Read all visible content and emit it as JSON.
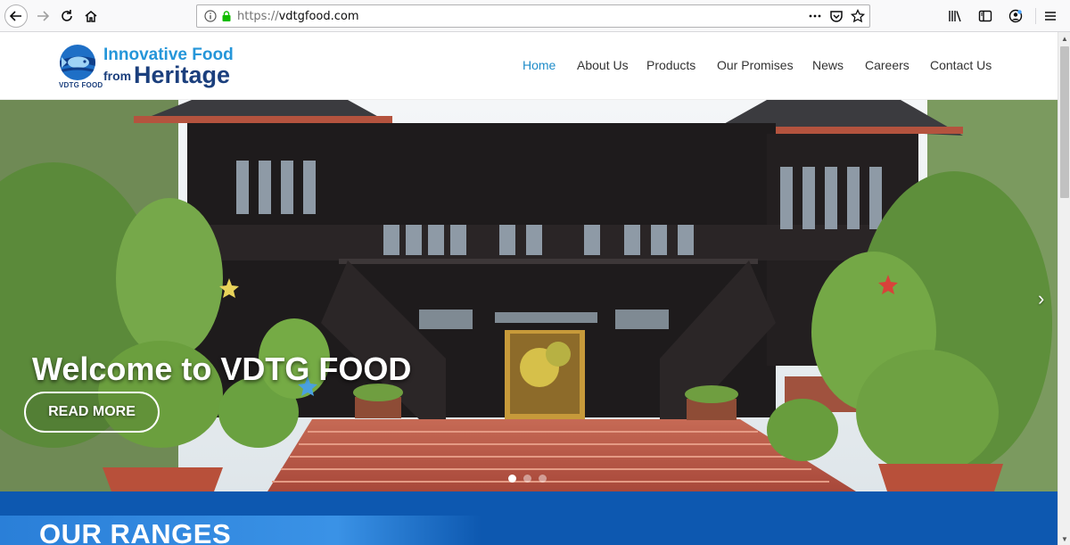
{
  "browser": {
    "url_scheme": "https://",
    "url_host": "vdtgfood.com",
    "icons": [
      "back-icon",
      "forward-icon",
      "reload-icon",
      "home-icon",
      "info-icon",
      "lock-icon",
      "more-icon",
      "pocket-icon",
      "bookmark-star-icon",
      "library-icon",
      "sidebar-icon",
      "account-icon",
      "menu-icon"
    ]
  },
  "logo": {
    "line1": "Innovative Food",
    "from": "from",
    "heritage": "Heritage",
    "sub": "VDTG FOOD",
    "colors": {
      "blue": "#2596d9",
      "navy": "#1b3f7d"
    }
  },
  "nav": {
    "active_color": "#1f8cc9",
    "items": [
      {
        "label": "Home"
      },
      {
        "label": "About Us"
      },
      {
        "label": "Products"
      },
      {
        "label": "Our Promises"
      },
      {
        "label": "News"
      },
      {
        "label": "Careers"
      },
      {
        "label": "Contact Us"
      }
    ]
  },
  "hero": {
    "title": "Welcome to VDTG FOOD",
    "button": "READ MORE",
    "slide_count": 3,
    "active_slide": 1
  },
  "ranges": {
    "title": "OUR RANGES",
    "color": "#0d58b0"
  }
}
